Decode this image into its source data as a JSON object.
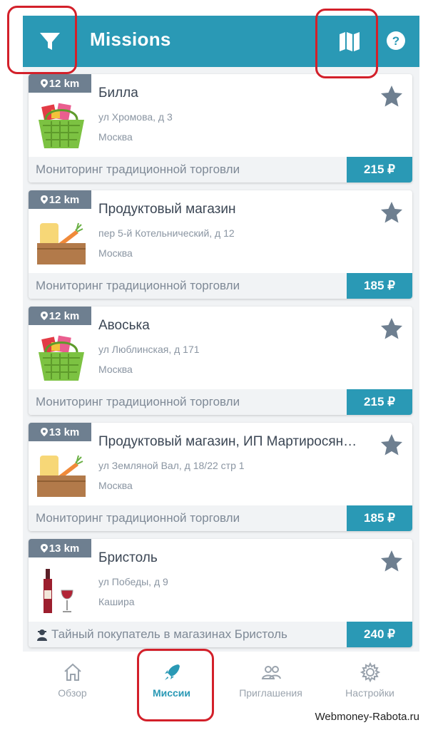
{
  "header": {
    "title": "Missions",
    "filter_icon": "filter-icon",
    "map_icon": "map-icon",
    "help_icon": "help-icon",
    "color": "#2a99b5"
  },
  "missions": [
    {
      "distance": "12 km",
      "name": "Билла",
      "address": "ул Хромова, д 3",
      "city": "Москва",
      "category": "Мониторинг традиционной торговли",
      "price": "215 ₽",
      "image": "grocery-basket"
    },
    {
      "distance": "12 km",
      "name": "Продуктовый магазин",
      "address": "пер 5-й Котельнический, д 12",
      "city": "Москва",
      "category": "Мониторинг традиционной торговли",
      "price": "185 ₽",
      "image": "grocery-box"
    },
    {
      "distance": "12 km",
      "name": "Авоська",
      "address": "ул Люблинская, д 171",
      "city": "Москва",
      "category": "Мониторинг традиционной торговли",
      "price": "215 ₽",
      "image": "grocery-basket"
    },
    {
      "distance": "13 km",
      "name": "Продуктовый магазин, ИП Мартиросян…",
      "address": "ул Земляной Вал, д 18/22 стр 1",
      "city": "Москва",
      "category": "Мониторинг традиционной торговли",
      "price": "185 ₽",
      "image": "grocery-box"
    },
    {
      "distance": "13 km",
      "name": "Бристоль",
      "address": "ул Победы, д 9",
      "city": "Кашира",
      "category": "Тайный покупатель в магазинах Бристоль",
      "price": "240 ₽",
      "image": "wine"
    }
  ],
  "nav": [
    {
      "label": "Обзор",
      "icon": "home-icon",
      "active": false
    },
    {
      "label": "Миссии",
      "icon": "rocket-icon",
      "active": true
    },
    {
      "label": "Приглашения",
      "icon": "people-icon",
      "active": false
    },
    {
      "label": "Настройки",
      "icon": "gear-icon",
      "active": false
    }
  ],
  "watermark": "Webmoney-Rabota.ru"
}
